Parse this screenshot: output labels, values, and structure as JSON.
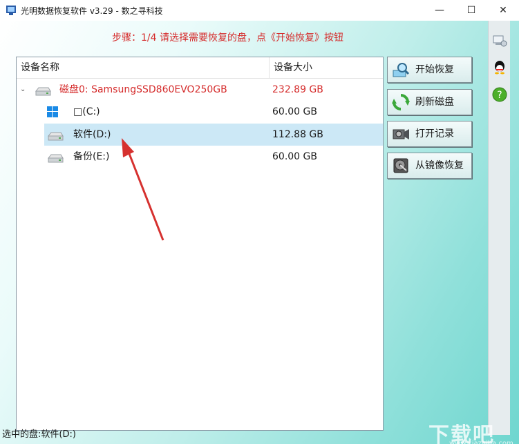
{
  "window": {
    "title": "光明数据恢复软件 v3.29 - 数之寻科技",
    "minimize": "—",
    "maximize": "☐",
    "close": "✕"
  },
  "step_text": "步骤：1/4 请选择需要恢复的盘，点《开始恢复》按钮",
  "table": {
    "col_name": "设备名称",
    "col_size": "设备大小",
    "rows": [
      {
        "name": "磁盘0: SamsungSSD860EVO250GB",
        "size": "232.89 GB",
        "icon": "disk-icon",
        "level": 0,
        "color": "#d52b2b"
      },
      {
        "name": "□(C:)",
        "size": "60.00 GB",
        "icon": "windows-icon",
        "level": 1
      },
      {
        "name": "软件(D:)",
        "size": "112.88 GB",
        "icon": "drive-icon",
        "level": 1,
        "selected": true
      },
      {
        "name": "备份(E:)",
        "size": "60.00 GB",
        "icon": "drive-icon",
        "level": 1
      }
    ]
  },
  "buttons": {
    "start": "开始恢复",
    "refresh": "刷新磁盘",
    "open_log": "打开记录",
    "from_image": "从镜像恢复"
  },
  "status": "选中的盘:软件(D:)",
  "watermark": {
    "logo": "下载吧",
    "site": "www.xiazaiba.com"
  },
  "colors": {
    "accent_red": "#d52b2b",
    "selection": "#cce8f6",
    "bg_teal": "#6fd6cf"
  }
}
